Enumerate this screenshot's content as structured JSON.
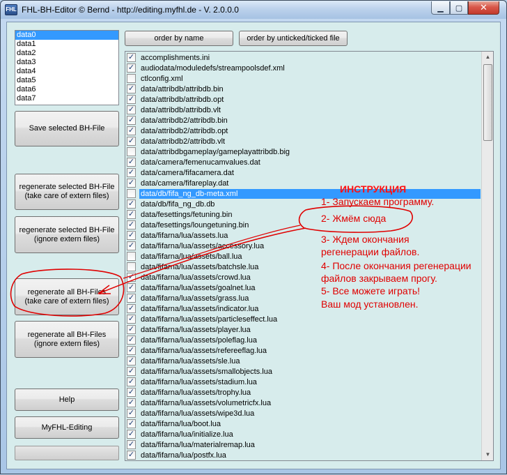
{
  "window": {
    "title": "FHL-BH-Editor © Bernd - http://editing.myfhl.de - V. 2.0.0.0",
    "icon_label": "FHL",
    "minimize_glyph": "▁",
    "maximize_glyph": "▢",
    "close_glyph": "✕"
  },
  "datalist": {
    "items": [
      "data0",
      "data1",
      "data2",
      "data3",
      "data4",
      "data5",
      "data6",
      "data7"
    ],
    "selected": 0
  },
  "buttons": {
    "save": "Save selected BH-File",
    "regen_sel_care_1": "regenerate selected BH-File",
    "regen_sel_care_2": "(take care of extern files)",
    "regen_sel_ignore_1": "regenerate selected BH-File",
    "regen_sel_ignore_2": "(ignore extern files)",
    "regen_all_care_1": "regenerate all BH-Files",
    "regen_all_care_2": "(take care of extern files)",
    "regen_all_ignore_1": "regenerate all BH-Files",
    "regen_all_ignore_2": "(ignore extern files)",
    "help": "Help",
    "myfhl": "MyFHL-Editing",
    "order_by_name": "order by name",
    "order_by_ticked": "order by unticked/ticked file"
  },
  "files": [
    {
      "name": "accomplishments.ini",
      "checked": true
    },
    {
      "name": "audiodata/moduledefs/streampoolsdef.xml",
      "checked": true
    },
    {
      "name": "ctlconfig.xml",
      "checked": false
    },
    {
      "name": "data/attribdb/attribdb.bin",
      "checked": true
    },
    {
      "name": "data/attribdb/attribdb.opt",
      "checked": true
    },
    {
      "name": "data/attribdb/attribdb.vlt",
      "checked": true
    },
    {
      "name": "data/attribdb2/attribdb.bin",
      "checked": true
    },
    {
      "name": "data/attribdb2/attribdb.opt",
      "checked": true
    },
    {
      "name": "data/attribdb2/attribdb.vlt",
      "checked": true
    },
    {
      "name": "data/attribdbgameplay/gameplayattribdb.big",
      "checked": false
    },
    {
      "name": "data/camera/femenucamvalues.dat",
      "checked": true
    },
    {
      "name": "data/camera/fifacamera.dat",
      "checked": true
    },
    {
      "name": "data/camera/fifareplay.dat",
      "checked": true
    },
    {
      "name": "data/db/fifa_ng_db-meta.xml",
      "checked": false
    },
    {
      "name": "data/db/fifa_ng_db.db",
      "checked": true
    },
    {
      "name": "data/fesettings/fetuning.bin",
      "checked": true
    },
    {
      "name": "data/fesettings/loungetuning.bin",
      "checked": true
    },
    {
      "name": "data/fifarna/lua/assets.lua",
      "checked": true
    },
    {
      "name": "data/fifarna/lua/assets/accessory.lua",
      "checked": true
    },
    {
      "name": "data/fifarna/lua/assets/ball.lua",
      "checked": false
    },
    {
      "name": "data/fifarna/lua/assets/batchsle.lua",
      "checked": false
    },
    {
      "name": "data/fifarna/lua/assets/crowd.lua",
      "checked": true
    },
    {
      "name": "data/fifarna/lua/assets/goalnet.lua",
      "checked": true
    },
    {
      "name": "data/fifarna/lua/assets/grass.lua",
      "checked": true
    },
    {
      "name": "data/fifarna/lua/assets/indicator.lua",
      "checked": true
    },
    {
      "name": "data/fifarna/lua/assets/particleseffect.lua",
      "checked": true
    },
    {
      "name": "data/fifarna/lua/assets/player.lua",
      "checked": true
    },
    {
      "name": "data/fifarna/lua/assets/poleflag.lua",
      "checked": true
    },
    {
      "name": "data/fifarna/lua/assets/refereeflag.lua",
      "checked": true
    },
    {
      "name": "data/fifarna/lua/assets/sle.lua",
      "checked": true
    },
    {
      "name": "data/fifarna/lua/assets/smallobjects.lua",
      "checked": true
    },
    {
      "name": "data/fifarna/lua/assets/stadium.lua",
      "checked": true
    },
    {
      "name": "data/fifarna/lua/assets/trophy.lua",
      "checked": true
    },
    {
      "name": "data/fifarna/lua/assets/volumetricfx.lua",
      "checked": true
    },
    {
      "name": "data/fifarna/lua/assets/wipe3d.lua",
      "checked": true
    },
    {
      "name": "data/fifarna/lua/boot.lua",
      "checked": true
    },
    {
      "name": "data/fifarna/lua/initialize.lua",
      "checked": true
    },
    {
      "name": "data/fifarna/lua/materialremap.lua",
      "checked": true
    },
    {
      "name": "data/fifarna/lua/postfx.lua",
      "checked": true
    }
  ],
  "selected_file": 13,
  "instructions": {
    "title": "ИНСТРУКЦИЯ",
    "step1": "1- Запускаем программу.",
    "step2": "2- Жмём сюда",
    "step3a": "3- Ждем окончания",
    "step3b": "регенерации файлов.",
    "step4a": "4- После окончания регенерации",
    "step4b": "файлов закрываем прогу.",
    "step5a": "5- Все можете играть!",
    "step5b": "Ваш мод установлен."
  },
  "colors": {
    "annotation": "#e00000",
    "selection": "#3399ff"
  }
}
